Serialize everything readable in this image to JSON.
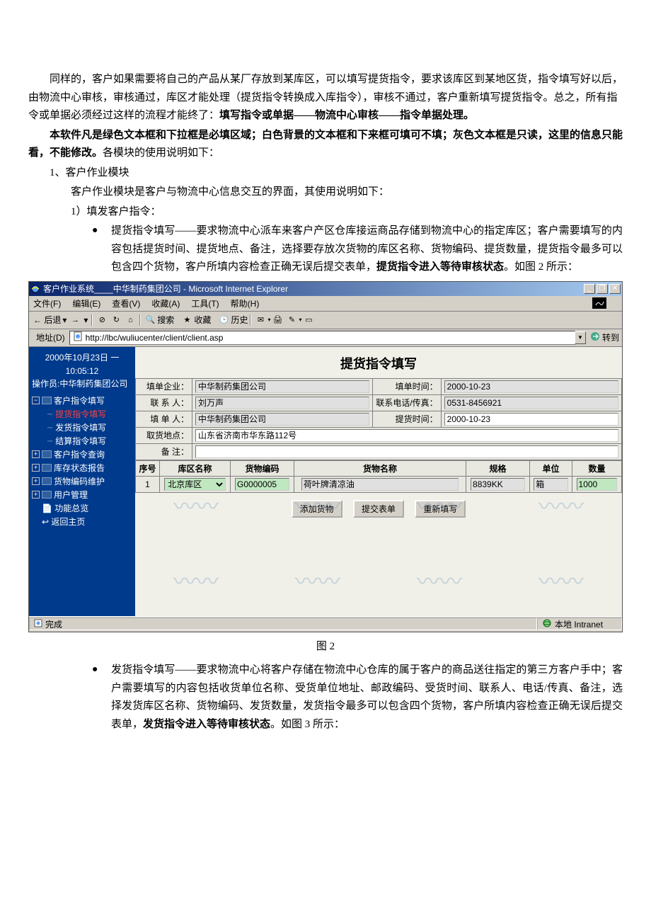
{
  "doc": {
    "p1": "同样的，客户如果需要将自己的产品从某厂存放到某库区，可以填写提货指令，要求该库区到某地区货，指令填写好以后，由物流中心审核，审核通过，库区才能处理（提货指令转换成入库指令），审核不通过，客户重新填写提货指令。总之，所有指令或单据必须经过这样的流程才能终了：",
    "p1_bold": "填写指令或单据——物流中心审核——指令单据处理。",
    "p2_bold": "本软件凡是绿色文本框和下拉框是必填区域；白色背景的文本框和下来框可填可不填；灰色文本框是只读，这里的信息只能看，不能修改。",
    "p2_tail": "各模块的使用说明如下：",
    "sec1_num": "1、客户作业模块",
    "sec1_desc": "客户作业模块是客户与物流中心信息交互的界面，其使用说明如下：",
    "sec1_sub1": "1）填发客户指令：",
    "bullet1_a": "提货指令填写——要求物流中心派车来客户产区仓库接运商品存储到物流中心的指定库区；客户需要填写的内容包括提货时间、提货地点、备注，选择要存放次货物的库区名称、货物编码、提货数量，提货指令最多可以包含四个货物，客户所填内容检查正确无误后提交表单，",
    "bullet1_b_bold": "提货指令进入等待审核状态",
    "bullet1_tail": "。如图 2 所示：",
    "fig2": "图 2",
    "bullet2_a": "发货指令填写——要求物流中心将客户存储在物流中心仓库的属于客户的商品送往指定的第三方客户手中；客户需要填写的内容包括收货单位名称、受货单位地址、邮政编码、受货时间、联系人、电话/传真、备注，选择发货库区名称、货物编码、发货数量，发货指令最多可以包含四个货物，客户所填内容检查正确无误后提交表单，",
    "bullet2_b_bold": "发货指令进入等待审核状态",
    "bullet2_tail": "。如图 3 所示："
  },
  "ie": {
    "title": "客户作业系统____中华制药集团公司 - Microsoft Internet Explorer",
    "menu": {
      "file": "文件(F)",
      "edit": "编辑(E)",
      "view": "查看(V)",
      "fav": "收藏(A)",
      "tools": "工具(T)",
      "help": "帮助(H)"
    },
    "toolbar": {
      "back": "← 后退",
      "search": "搜索",
      "fav": "收藏",
      "history": "历史"
    },
    "addr_label": "地址(D)",
    "url": "http://lbc/wuliucenter/client/client.asp",
    "go": "转到",
    "status_done": "完成",
    "status_zone": "本地 Intranet"
  },
  "sidebar": {
    "date": "2000年10月23日 一",
    "time": "10:05:12",
    "operator_label": "操作员:",
    "operator_name": "中华制药集团公司",
    "items": [
      {
        "label": "客户指令填写",
        "children": [
          {
            "label": "提货指令填写",
            "active": true
          },
          {
            "label": "发货指令填写"
          },
          {
            "label": "结算指令填写"
          }
        ]
      },
      {
        "label": "客户指令查询"
      },
      {
        "label": "库存状态报告"
      },
      {
        "label": "货物编码维护"
      },
      {
        "label": "用户管理"
      },
      {
        "label": "功能总览"
      },
      {
        "label": "返回主页"
      }
    ]
  },
  "form": {
    "title": "提货指令填写",
    "company_lbl": "填单企业：",
    "company": "中华制药集团公司",
    "filltime_lbl": "填单时间：",
    "filltime": "2000-10-23",
    "contact_lbl": "联 系 人：",
    "contact": "刘万声",
    "phone_lbl": "联系电话/传真：",
    "phone": "0531-8456921",
    "filler_lbl": "填 单 人：",
    "filler": "中华制药集团公司",
    "picktime_lbl": "提货时间：",
    "picktime": "2000-10-23",
    "pickaddr_lbl": "取货地点：",
    "pickaddr": "山东省济南市华东路112号",
    "remark_lbl": "备    注：",
    "remark": ""
  },
  "grid": {
    "headers": {
      "seq": "序号",
      "warehouse": "库区名称",
      "code": "货物编码",
      "name": "货物名称",
      "spec": "规格",
      "unit": "单位",
      "qty": "数量"
    },
    "rows": [
      {
        "seq": "1",
        "warehouse": "北京库区",
        "code": "G0000005",
        "name": "荷叶牌清凉油",
        "spec": "8839KK",
        "unit": "箱",
        "qty": "1000"
      }
    ]
  },
  "buttons": {
    "add": "添加货物",
    "submit": "提交表单",
    "reset": "重新填写"
  }
}
